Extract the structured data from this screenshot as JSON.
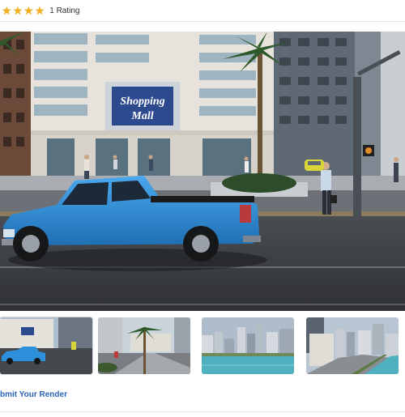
{
  "rating": {
    "stars": 4,
    "max_stars": 4,
    "label": "1 Rating"
  },
  "main_image": {
    "sign_line1": "Shopping",
    "sign_line2": "Mall",
    "truck_color": "#2e8fdb"
  },
  "thumbnails": [
    {
      "name": "thumb-truck-mall",
      "active": true
    },
    {
      "name": "thumb-street-palms",
      "active": false
    },
    {
      "name": "thumb-city-water",
      "active": false
    },
    {
      "name": "thumb-waterfront-road",
      "active": false
    }
  ],
  "footer": {
    "submit_label": "bmit Your Render",
    "link_color": "#2a64b8"
  }
}
